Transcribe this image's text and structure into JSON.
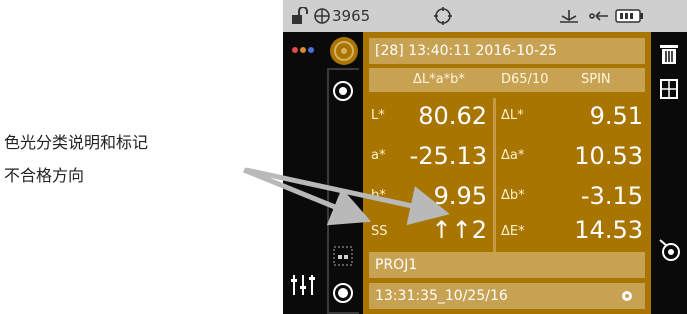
{
  "annotation": {
    "line1": "色光分类说明和标记",
    "line2": "不合格方向"
  },
  "statusbar": {
    "sample_count": "3965"
  },
  "header": {
    "sample_line": "[28] 13:40:11 2016-10-25",
    "mode": "ΔL*a*b*",
    "illuminant": "D65/10",
    "spec": "SPIN"
  },
  "readings": {
    "L_label": "L*",
    "L_value": "80.62",
    "a_label": "a*",
    "a_value": "-25.13",
    "b_label": "b*",
    "b_value": "9.95",
    "ss_label": "SS",
    "ss_value": "↑↑2"
  },
  "deltas": {
    "dL_label": "ΔL*",
    "dL_value": "9.51",
    "da_label": "Δa*",
    "da_value": "10.53",
    "db_label": "Δb*",
    "db_value": "-3.15",
    "dE_label": "ΔE*",
    "dE_value": "14.53"
  },
  "project": {
    "name": "PROJ1"
  },
  "standard": {
    "timestamp": "13:31:35_10/25/16"
  },
  "colors": {
    "panel": "#a87500",
    "bar": "#c8a253",
    "status": "#cfcfcf"
  },
  "icons": [
    "lock-icon",
    "target-icon",
    "crosshair-icon",
    "usb-icon",
    "connection-icon",
    "battery-icon",
    "dots-icon",
    "measure-button-icon",
    "trash-icon",
    "settings-icon",
    "sliders-icon",
    "tiles-icon",
    "record-icon",
    "rotate-icon"
  ]
}
